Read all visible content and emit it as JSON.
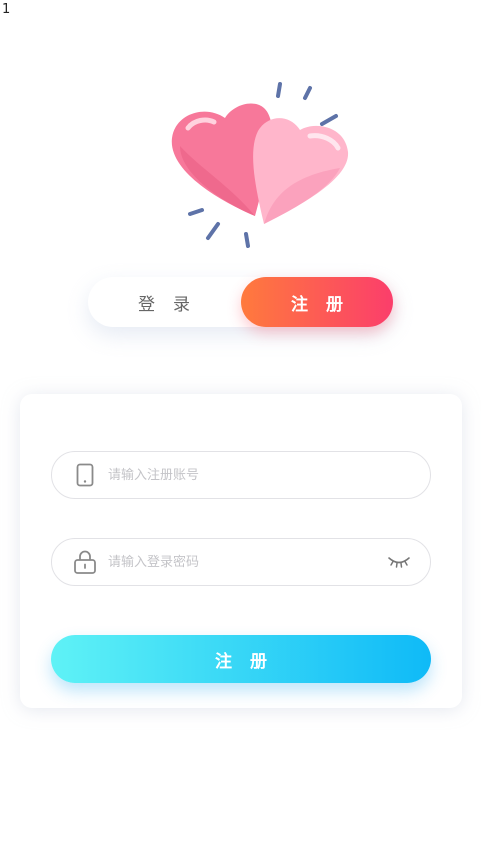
{
  "status_bar": {
    "indicator": "1"
  },
  "hero": {
    "icon": "double-heart-icon"
  },
  "tabs": {
    "login_label": "登录",
    "register_label": "注册",
    "active": "register"
  },
  "form": {
    "account_placeholder": "请输入注册账号",
    "password_placeholder": "请输入登录密码",
    "account_icon": "phone-icon",
    "password_icon": "lock-icon",
    "visibility_icon": "eye-closed-icon",
    "submit_label": "注册"
  },
  "colors": {
    "register_tab_start": "#ff7a3d",
    "register_tab_end": "#fb3e6b",
    "submit_start": "#5ff2f6",
    "submit_end": "#0fbaf7"
  }
}
